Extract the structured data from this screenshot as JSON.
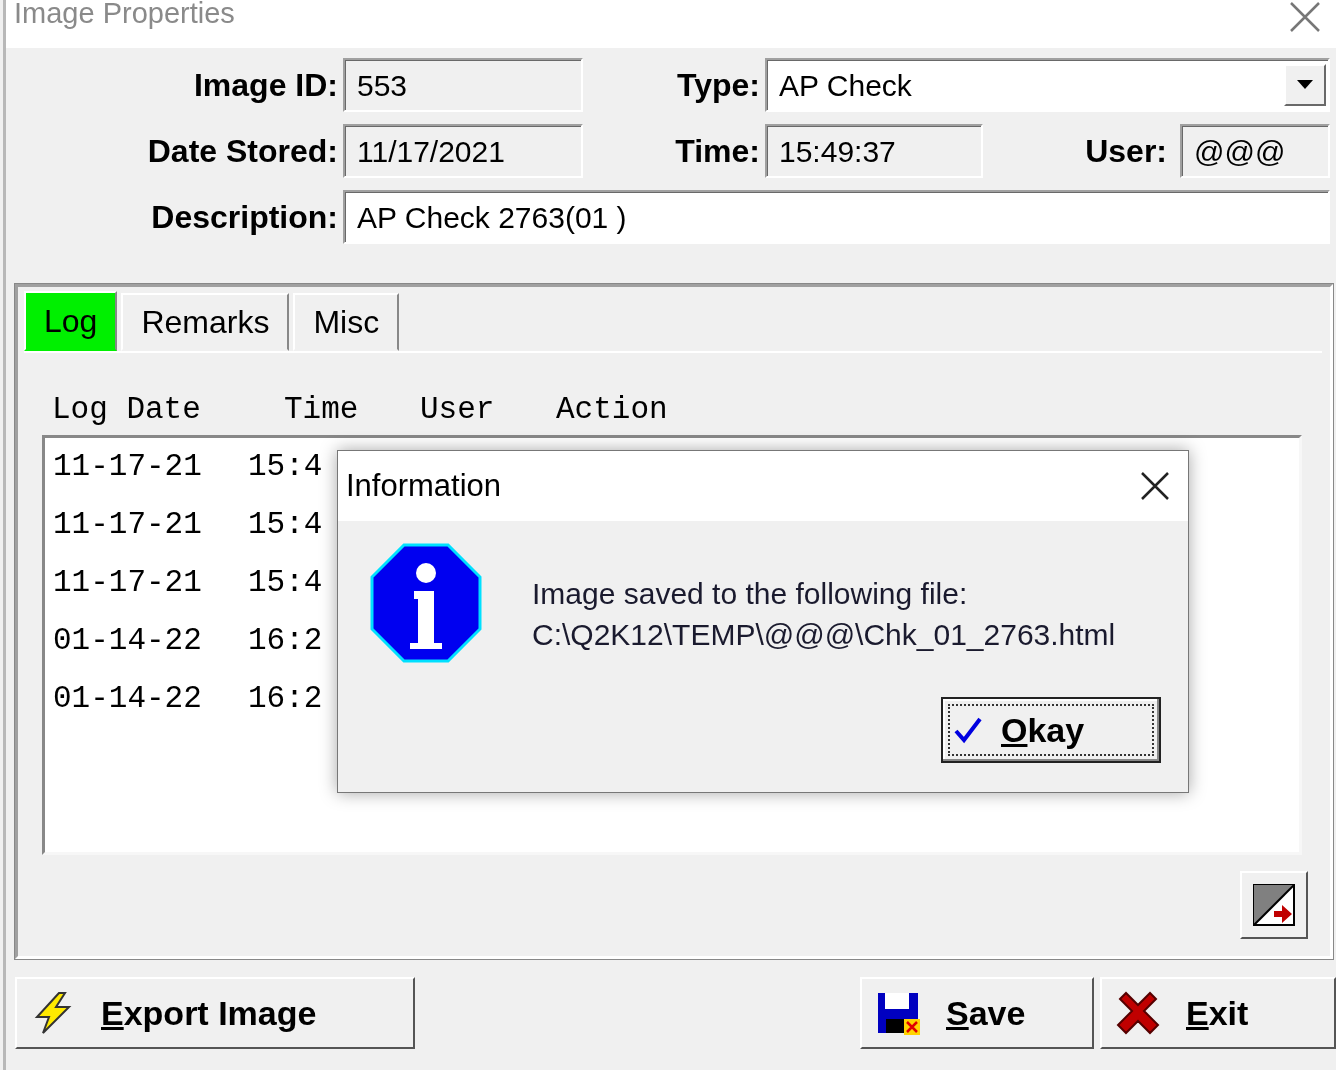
{
  "window": {
    "title": "Image Properties"
  },
  "field_rows": [
    [
      {
        "label": "Image ID:",
        "value": "553",
        "kind": "readonly"
      },
      {
        "label": "Type:",
        "value": "AP Check",
        "kind": "dropdown"
      }
    ],
    [
      {
        "label": "Date Stored:",
        "value": "11/17/2021",
        "kind": "readonly"
      },
      {
        "label": "Time:",
        "value": "15:49:37",
        "kind": "readonly"
      },
      {
        "label": "User:",
        "value": "@@@",
        "kind": "readonly"
      }
    ],
    [
      {
        "label": "Description:",
        "value": "AP Check 2763(01 )",
        "kind": "editable"
      }
    ]
  ],
  "tabs": [
    {
      "label": "Log",
      "selected": true
    },
    {
      "label": "Remarks",
      "selected": false
    },
    {
      "label": "Misc",
      "selected": false
    }
  ],
  "log": {
    "columns": [
      "Log Date",
      "Time",
      "User",
      "Action"
    ],
    "rows": [
      {
        "log_date": "11-17-21",
        "time": "15:4"
      },
      {
        "log_date": "11-17-21",
        "time": "15:4"
      },
      {
        "log_date": "11-17-21",
        "time": "15:4"
      },
      {
        "log_date": "01-14-22",
        "time": "16:2"
      },
      {
        "log_date": "01-14-22",
        "time": "16:2"
      }
    ]
  },
  "buttons": [
    {
      "label": "Export Image",
      "kind": "export",
      "mnemonic_underlined": true
    },
    {
      "label": "Save",
      "kind": "save",
      "mnemonic_underlined": true
    },
    {
      "label": "Exit",
      "kind": "exit",
      "mnemonic_underlined": true
    }
  ],
  "dialog": {
    "title": "Information",
    "message": [
      "Image saved to the following file:",
      "C:\\Q2K12\\TEMP\\@@@\\Chk_01_2763.html"
    ],
    "button": {
      "label": "Okay",
      "mnemonic_underlined": true
    }
  }
}
